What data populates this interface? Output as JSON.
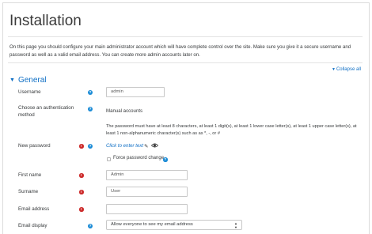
{
  "page": {
    "title": "Installation",
    "intro": "On this page you should configure your main administrator account which will have complete control over the site. Make sure you give it a secure username and password as well as a valid email address. You can create more admin accounts later on.",
    "collapse_all": "Collapse all"
  },
  "section": {
    "title": "General"
  },
  "fields": {
    "username": {
      "label": "Username",
      "value": "admin"
    },
    "auth": {
      "label": "Choose an authentication method",
      "value": "Manual accounts"
    },
    "password_policy": "The password must have at least 8 characters, at least 1 digit(s), at least 1 lower case letter(s), at least 1 upper case letter(s), at least 1 non-alphanumeric character(s) such as as *, -, or #",
    "new_password": {
      "label": "New password",
      "link": "Click to enter text"
    },
    "force_change": {
      "label": "Force password change",
      "checked": false
    },
    "first_name": {
      "label": "First name",
      "value": "Admin"
    },
    "surname": {
      "label": "Surname",
      "value": "User"
    },
    "email": {
      "label": "Email address",
      "value": ""
    },
    "email_display": {
      "label": "Email display",
      "value": "Allow everyone to see my email address"
    }
  },
  "icons": {
    "help": "?",
    "required": "!"
  },
  "colors": {
    "link": "#0f6fc5",
    "help_icon": "#1a8bd6",
    "required_icon": "#cc2a2a"
  }
}
